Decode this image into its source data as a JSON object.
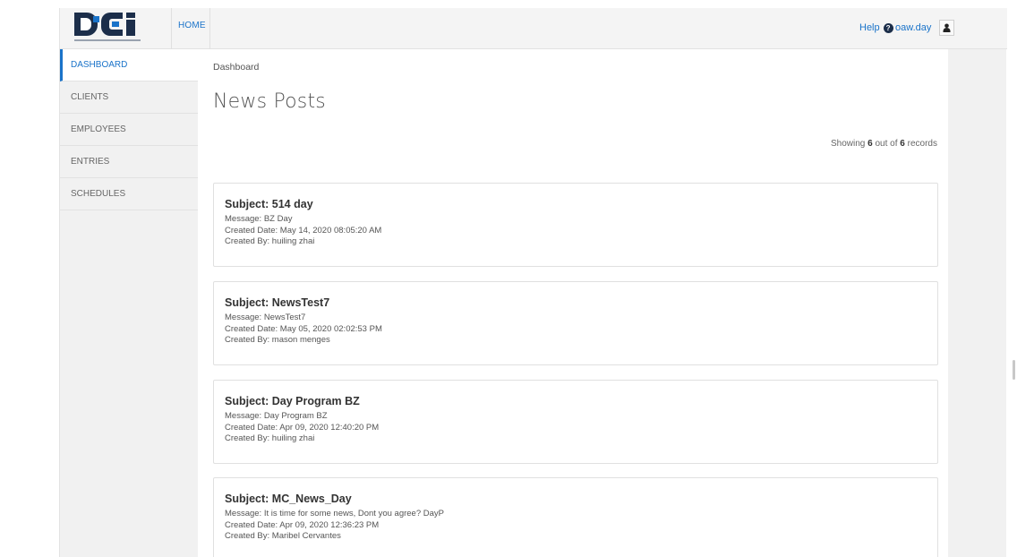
{
  "nav": {
    "home_label": "HOME",
    "help_label": "Help",
    "user_label": "oaw.day"
  },
  "sidebar": {
    "items": [
      {
        "label": "DASHBOARD",
        "active": true
      },
      {
        "label": "CLIENTS",
        "active": false
      },
      {
        "label": "EMPLOYEES",
        "active": false
      },
      {
        "label": "ENTRIES",
        "active": false
      },
      {
        "label": "SCHEDULES",
        "active": false
      }
    ]
  },
  "main": {
    "breadcrumb": "Dashboard",
    "title": "News Posts",
    "showing": {
      "prefix": "Showing",
      "shown": "6",
      "middle": "out of",
      "total": "6",
      "suffix": "records"
    },
    "posts": [
      {
        "subject": "Subject: 514 day",
        "message": "Message: BZ Day",
        "created_date": "Created Date: May 14, 2020 08:05:20 AM",
        "created_by": "Created By: huiling zhai"
      },
      {
        "subject": "Subject: NewsTest7",
        "message": "Message: NewsTest7",
        "created_date": "Created Date: May 05, 2020 02:02:53 PM",
        "created_by": "Created By: mason menges"
      },
      {
        "subject": "Subject: Day Program BZ",
        "message": "Message: Day Program BZ",
        "created_date": "Created Date: Apr 09, 2020 12:40:20 PM",
        "created_by": "Created By: huiling zhai"
      },
      {
        "subject": "Subject: MC_News_Day",
        "message": "Message: It is time for some news, Dont you agree? DayP",
        "created_date": "Created Date: Apr 09, 2020 12:36:23 PM",
        "created_by": "Created By: Maribel Cervantes"
      }
    ]
  },
  "colors": {
    "accent": "#1a73c9",
    "logo_navy": "#1c2e4a",
    "sidebar_bg": "#f1f1f1"
  },
  "icons": {
    "help": "question-circle-icon",
    "user": "user-icon"
  }
}
